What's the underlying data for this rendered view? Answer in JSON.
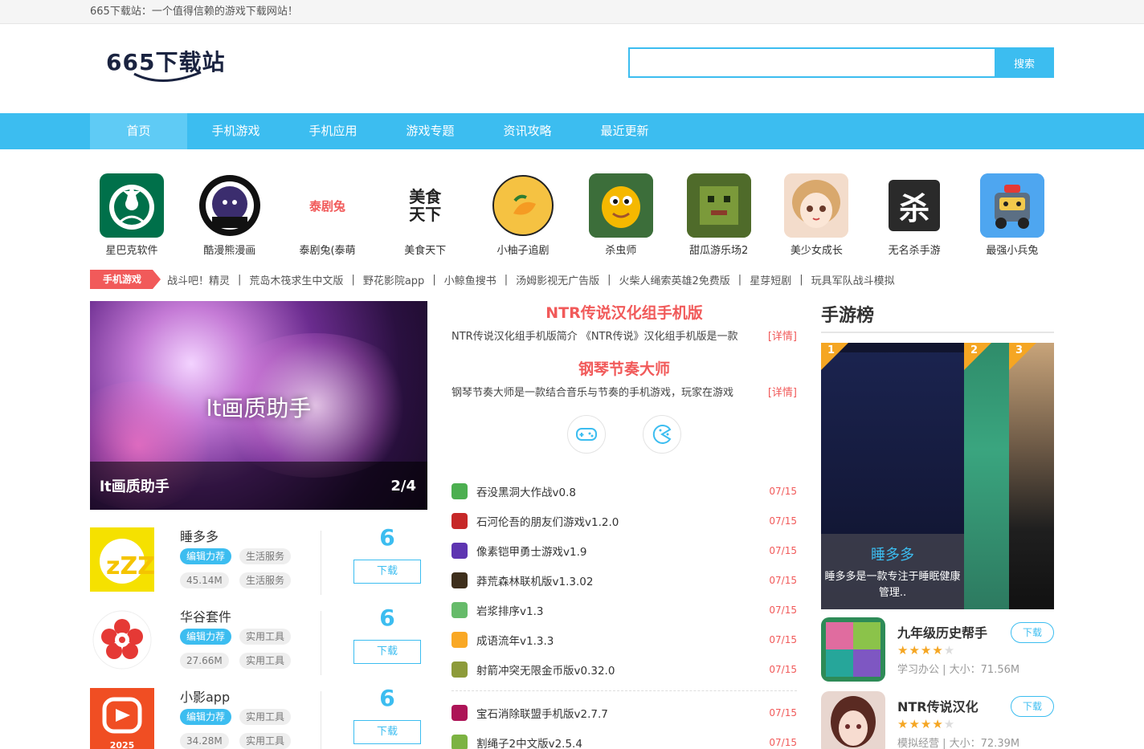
{
  "topbar": {
    "text": "665下载站：一个值得信赖的游戏下载网站！"
  },
  "header": {
    "logo_text": "665下载站",
    "search_placeholder": "",
    "search_button": "搜索"
  },
  "nav": [
    "首页",
    "手机游戏",
    "手机应用",
    "游戏专题",
    "资讯攻略",
    "最近更新"
  ],
  "icon_row": [
    {
      "name": "星巴克软件",
      "icon": "starbucks-logo-icon",
      "color": "#00704a"
    },
    {
      "name": "酷漫熊漫画",
      "icon": "kumanxiong-logo-icon",
      "color": "#111111"
    },
    {
      "name": "泰剧兔(泰萌",
      "icon": "taijutu-logo-icon",
      "color": "#f15a5a",
      "logo_text": "泰剧兔"
    },
    {
      "name": "美食天下",
      "icon": "meishi-logo-icon",
      "color": "#222222",
      "logo_text": "美食天下"
    },
    {
      "name": "小柚子追剧",
      "icon": "grapefruit-icon",
      "color": "#f5c242"
    },
    {
      "name": "杀虫师",
      "icon": "bug-game-icon",
      "color": "#f5b800"
    },
    {
      "name": "甜瓜游乐场2",
      "icon": "melon-game-icon",
      "color": "#5a7a2a"
    },
    {
      "name": "美少女成长",
      "icon": "anime-girl-icon",
      "color": "#f2d2c0"
    },
    {
      "name": "无名杀手游",
      "icon": "wumingsha-logo-icon",
      "color": "#222222",
      "logo_text": "杀"
    },
    {
      "name": "最强小兵兔",
      "icon": "robot-game-icon",
      "color": "#3a8fe0"
    }
  ],
  "tagline": {
    "tag": "手机游戏",
    "links": [
      "战斗吧！精灵",
      "荒岛木筏求生中文版",
      "野花影院app",
      "小鲸鱼搜书",
      "汤姆影视无广告版",
      "火柴人绳索英雄2免费版",
      "星芽短剧",
      "玩具军队战斗模拟"
    ]
  },
  "banner": {
    "center_text": "lt画质助手",
    "title": "lt画质助手",
    "pager": "2/4"
  },
  "left_apps": [
    {
      "name": "睡多多",
      "tag1": "编辑力荐",
      "tag2": "生活服务",
      "size": "45.14M",
      "tag3": "生活服务",
      "score": "6",
      "button": "下载",
      "icon": "sleep-zzz-icon"
    },
    {
      "name": "华谷套件",
      "tag1": "编辑力荐",
      "tag2": "实用工具",
      "size": "27.66M",
      "tag3": "实用工具",
      "score": "6",
      "button": "下载",
      "icon": "flower-icon"
    },
    {
      "name": "小影app",
      "tag1": "编辑力荐",
      "tag2": "实用工具",
      "size": "34.28M",
      "tag3": "实用工具",
      "score": "6",
      "button": "下载",
      "icon": "xiaoying-icon",
      "year": "2025"
    }
  ],
  "featured": [
    {
      "title": "NTR传说汉化组手机版",
      "desc": "NTR传说汉化组手机版简介 《NTR传说》汉化组手机版是一款",
      "more": "[详情]"
    },
    {
      "title": "钢琴节奏大师",
      "desc": "钢琴节奏大师是一款结合音乐与节奏的手机游戏，玩家在游戏",
      "more": "[详情]"
    }
  ],
  "news": [
    {
      "title": "吞没黑洞大作战v0.8",
      "date": "07/15",
      "color": "#4caf50"
    },
    {
      "title": "石河伦吾的朋友们游戏v1.2.0",
      "date": "07/15",
      "color": "#c62828"
    },
    {
      "title": "像素铠甲勇士游戏v1.9",
      "date": "07/15",
      "color": "#5e35b1"
    },
    {
      "title": "莽荒森林联机版v1.3.02",
      "date": "07/15",
      "color": "#3e2f1c"
    },
    {
      "title": "岩浆排序v1.3",
      "date": "07/15",
      "color": "#66bb6a"
    },
    {
      "title": "成语流年v1.3.3",
      "date": "07/15",
      "color": "#f9a825"
    },
    {
      "title": "射箭冲突无限金币版v0.32.0",
      "date": "07/15",
      "color": "#8d9b3a"
    },
    {
      "title": "宝石消除联盟手机版v2.7.7",
      "date": "07/15",
      "color": "#ad1457"
    },
    {
      "title": "割绳子2中文版v2.5.4",
      "date": "07/15",
      "color": "#7cb342"
    }
  ],
  "rank": {
    "heading": "手游榜",
    "big": {
      "num": "1",
      "title": "睡多多",
      "desc": "睡多多是一款专注于睡眠健康管理.."
    },
    "small": [
      {
        "num": "2"
      },
      {
        "num": "3"
      }
    ],
    "items": [
      {
        "name": "九年级历史帮手",
        "stars": 4,
        "meta": "学习办公 | 大小：71.56M",
        "button": "下载",
        "icon": "history-helper-icon"
      },
      {
        "name": "NTR传说汉化",
        "stars": 4,
        "meta": "模拟经营 | 大小：72.39M",
        "button": "下载",
        "icon": "anime-portrait-icon"
      }
    ]
  }
}
